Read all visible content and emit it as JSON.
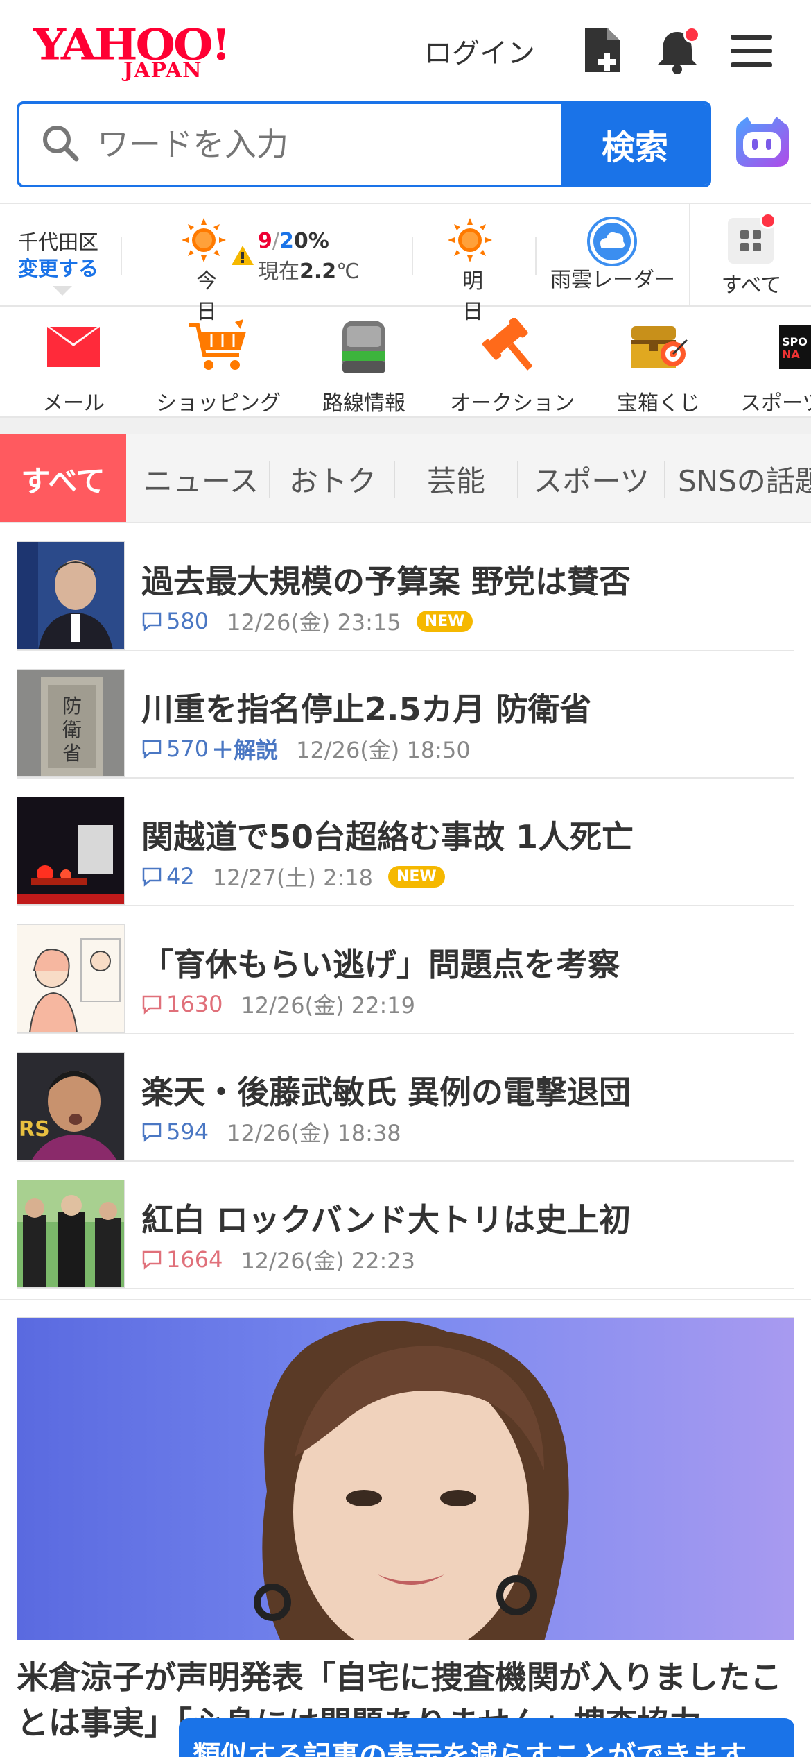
{
  "header": {
    "logo_main": "YAHOO!",
    "logo_sub": "JAPAN",
    "login_label": "ログイン"
  },
  "search": {
    "placeholder": "ワードを入力",
    "button_label": "検索"
  },
  "weather": {
    "location_name": "千代田区",
    "change_label": "変更する",
    "today_label": "今日",
    "high": "9",
    "low": "2",
    "precip": "0%",
    "now_prefix": "現在",
    "now_temp": "2.2",
    "now_unit": "℃",
    "tomorrow_label": "明日",
    "radar_label": "雨雲レーダー",
    "all_label": "すべて"
  },
  "services": [
    {
      "label": "メール",
      "icon": "mail-icon"
    },
    {
      "label": "ショッピング",
      "icon": "cart-icon"
    },
    {
      "label": "路線情報",
      "icon": "train-icon"
    },
    {
      "label": "オークション",
      "icon": "gavel-icon"
    },
    {
      "label": "宝箱くじ",
      "icon": "treasure-icon"
    },
    {
      "label": "スポーツ",
      "icon": "sports-icon"
    }
  ],
  "tabs": [
    {
      "label": "すべて",
      "active": true
    },
    {
      "label": "ニュース"
    },
    {
      "label": "おトク"
    },
    {
      "label": "芸能"
    },
    {
      "label": "スポーツ"
    },
    {
      "label": "SNSの話題"
    }
  ],
  "news": [
    {
      "title": "過去最大規模の予算案 野党は賛否",
      "comments": "580",
      "extra": "",
      "time": "12/26(金) 23:15",
      "is_new": true,
      "new_label": "NEW",
      "comment_color": "blue"
    },
    {
      "title": "川重を指名停止2.5カ月 防衛省",
      "comments": "570",
      "extra": "＋解説",
      "time": "12/26(金) 18:50",
      "is_new": false,
      "comment_color": "blue"
    },
    {
      "title": "関越道で50台超絡む事故 1人死亡",
      "comments": "42",
      "extra": "",
      "time": "12/27(土) 2:18",
      "is_new": true,
      "new_label": "NEW",
      "comment_color": "blue"
    },
    {
      "title": "「育休もらい逃げ」問題点を考察",
      "comments": "1630",
      "extra": "",
      "time": "12/26(金) 22:19",
      "is_new": false,
      "comment_color": "red"
    },
    {
      "title": "楽天・後藤武敏氏 異例の電撃退団",
      "comments": "594",
      "extra": "",
      "time": "12/26(金) 18:38",
      "is_new": false,
      "comment_color": "blue"
    },
    {
      "title": "紅白 ロックバンド大トリは史上初",
      "comments": "1664",
      "extra": "",
      "time": "12/26(金) 22:23",
      "is_new": false,
      "comment_color": "red"
    }
  ],
  "feature": {
    "title": "米倉涼子が声明発表「自宅に捜査機関が入りましたことは事実」「心身には問題ありません」捜査協力"
  },
  "toast": {
    "text": "類似する記事の表示を減らすことができます"
  },
  "colors": {
    "brand_red": "#ff0033",
    "accent_blue": "#1a73e8",
    "tab_active": "#ff5a5f",
    "new_badge": "#f5b800"
  }
}
